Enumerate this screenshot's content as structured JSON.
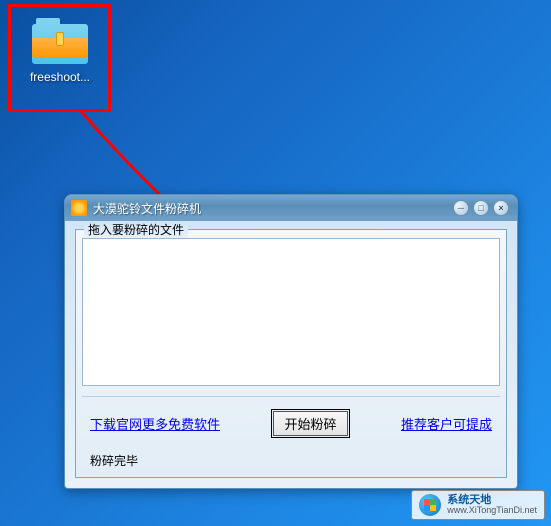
{
  "desktop": {
    "icon_label": "freeshoot..."
  },
  "window": {
    "title": "大漠驼铃文件粉碎机",
    "controls": {
      "min": "─",
      "max": "□",
      "close": "×"
    },
    "group_legend": "拖入要粉碎的文件",
    "link_left": "下载官网更多免费软件",
    "action_button": "开始粉碎",
    "link_right": "推荐客户可提成",
    "status": "粉碎完毕"
  },
  "watermark": {
    "name": "系统天地",
    "url": "www.XiTongTianDi.net"
  }
}
